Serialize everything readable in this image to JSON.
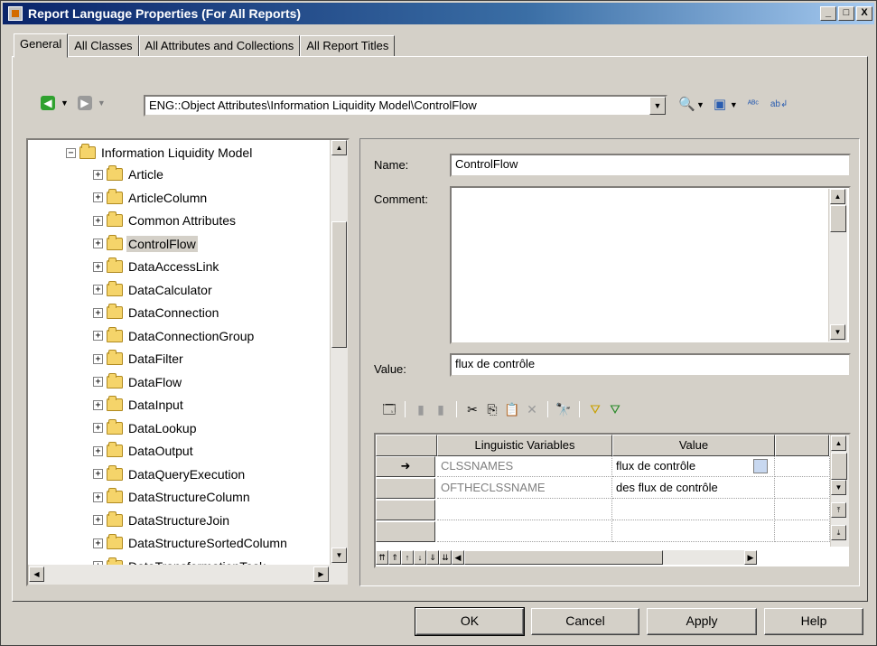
{
  "window": {
    "title": "Report Language Properties (For All Reports)",
    "minimize": "_",
    "maximize": "□",
    "close": "X"
  },
  "tabs": [
    "General",
    "All Classes",
    "All Attributes and Collections",
    "All Report Titles"
  ],
  "toolbar": {
    "path": "ENG::Object Attributes\\Information Liquidity Model\\ControlFlow",
    "back_icon": "back-arrow-icon",
    "forward_icon": "forward-arrow-icon"
  },
  "tree": {
    "root": "Information Liquidity Model",
    "items": [
      "Article",
      "ArticleColumn",
      "Common Attributes",
      "ControlFlow",
      "DataAccessLink",
      "DataCalculator",
      "DataConnection",
      "DataConnectionGroup",
      "DataFilter",
      "DataFlow",
      "DataInput",
      "DataLookup",
      "DataOutput",
      "DataQueryExecution",
      "DataStructureColumn",
      "DataStructureJoin",
      "DataStructureSortedColumn",
      "DataTransformationTask"
    ],
    "selected": "ControlFlow"
  },
  "form": {
    "name_label": "Name:",
    "name_value": "ControlFlow",
    "comment_label": "Comment:",
    "comment_value": "",
    "value_label": "Value:",
    "value_value": "flux de contrôle"
  },
  "grid": {
    "headers": [
      "Linguistic Variables",
      "Value"
    ],
    "rows": [
      {
        "marker": "➜",
        "variable": "CLSSNAMES",
        "value": "flux de contrôle"
      },
      {
        "marker": "",
        "variable": "OFTHECLSSNAME",
        "value": "des flux de contrôle"
      },
      {
        "marker": "",
        "variable": "",
        "value": ""
      },
      {
        "marker": "",
        "variable": "",
        "value": ""
      }
    ]
  },
  "buttons": {
    "ok": "OK",
    "cancel": "Cancel",
    "apply": "Apply",
    "help": "Help"
  }
}
